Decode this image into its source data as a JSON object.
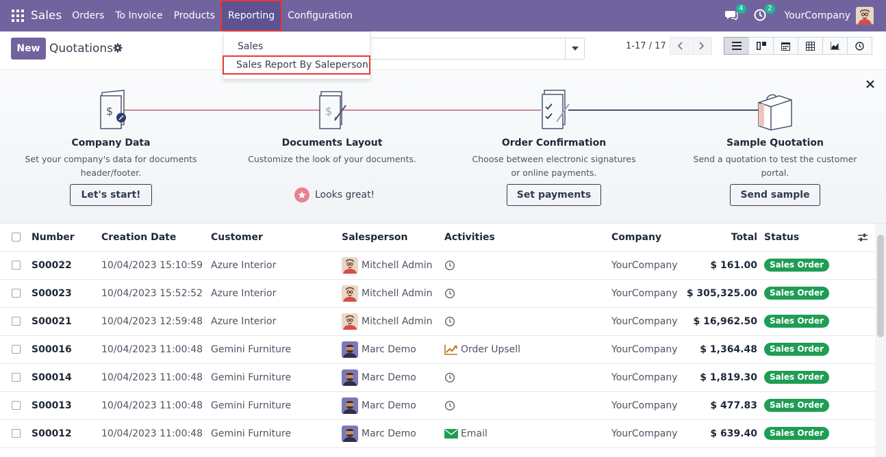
{
  "app": {
    "name": "Sales"
  },
  "nav": [
    {
      "label": "Orders"
    },
    {
      "label": "To Invoice"
    },
    {
      "label": "Products"
    },
    {
      "label": "Reporting"
    },
    {
      "label": "Configuration"
    }
  ],
  "topbar": {
    "messages_count": "4",
    "activities_count": "2",
    "company": "YourCompany"
  },
  "reporting_menu": [
    {
      "label": "Sales"
    },
    {
      "label": "Sales Report By Saleperson"
    }
  ],
  "control": {
    "new_label": "New",
    "title": "Quotations",
    "pager": "1-17 / 17"
  },
  "onboarding": [
    {
      "title": "Company Data",
      "desc1": "Set your company's data for documents",
      "desc2": "header/footer.",
      "button": "Let's start!"
    },
    {
      "title": "Documents Layout",
      "desc1": "Customize the look of your documents.",
      "desc2": "",
      "done": "Looks great!"
    },
    {
      "title": "Order Confirmation",
      "desc1": "Choose between electronic signatures",
      "desc2": "or online payments.",
      "button": "Set payments"
    },
    {
      "title": "Sample Quotation",
      "desc1": "Send a quotation to test the customer",
      "desc2": "portal.",
      "button": "Send sample"
    }
  ],
  "table": {
    "headers": {
      "number": "Number",
      "date": "Creation Date",
      "customer": "Customer",
      "salesperson": "Salesperson",
      "activities": "Activities",
      "company": "Company",
      "total": "Total",
      "status": "Status"
    },
    "rows": [
      {
        "number": "S00022",
        "date": "10/04/2023 15:10:59",
        "customer": "Azure Interior",
        "salesperson": "Mitchell Admin",
        "avatar": "mitchell",
        "activity_icon": "clock-icon",
        "activity": "",
        "company": "YourCompany",
        "total": "$ 161.00",
        "status": "Sales Order"
      },
      {
        "number": "S00023",
        "date": "10/04/2023 15:52:52",
        "customer": "Azure Interior",
        "salesperson": "Mitchell Admin",
        "avatar": "mitchell",
        "activity_icon": "clock-icon",
        "activity": "",
        "company": "YourCompany",
        "total": "$ 305,325.00",
        "status": "Sales Order"
      },
      {
        "number": "S00021",
        "date": "10/04/2023 12:59:48",
        "customer": "Azure Interior",
        "salesperson": "Mitchell Admin",
        "avatar": "mitchell",
        "activity_icon": "clock-icon",
        "activity": "",
        "company": "YourCompany",
        "total": "$ 16,962.50",
        "status": "Sales Order"
      },
      {
        "number": "S00016",
        "date": "10/04/2023 11:00:48",
        "customer": "Gemini Furniture",
        "salesperson": "Marc Demo",
        "avatar": "marc",
        "activity_icon": "chart-line-icon",
        "activity": "Order Upsell",
        "company": "YourCompany",
        "total": "$ 1,364.48",
        "status": "Sales Order"
      },
      {
        "number": "S00014",
        "date": "10/04/2023 11:00:48",
        "customer": "Gemini Furniture",
        "salesperson": "Marc Demo",
        "avatar": "marc",
        "activity_icon": "clock-icon",
        "activity": "",
        "company": "YourCompany",
        "total": "$ 1,819.30",
        "status": "Sales Order"
      },
      {
        "number": "S00013",
        "date": "10/04/2023 11:00:48",
        "customer": "Gemini Furniture",
        "salesperson": "Marc Demo",
        "avatar": "marc",
        "activity_icon": "clock-icon",
        "activity": "",
        "company": "YourCompany",
        "total": "$ 477.83",
        "status": "Sales Order"
      },
      {
        "number": "S00012",
        "date": "10/04/2023 11:00:48",
        "customer": "Gemini Furniture",
        "salesperson": "Marc Demo",
        "avatar": "marc",
        "activity_icon": "envelope-icon",
        "activity": "Email",
        "company": "YourCompany",
        "total": "$ 639.40",
        "status": "Sales Order"
      }
    ]
  },
  "colors": {
    "brand": "#71639e",
    "status_green": "#1f9d55",
    "highlight_red": "#e53935"
  }
}
